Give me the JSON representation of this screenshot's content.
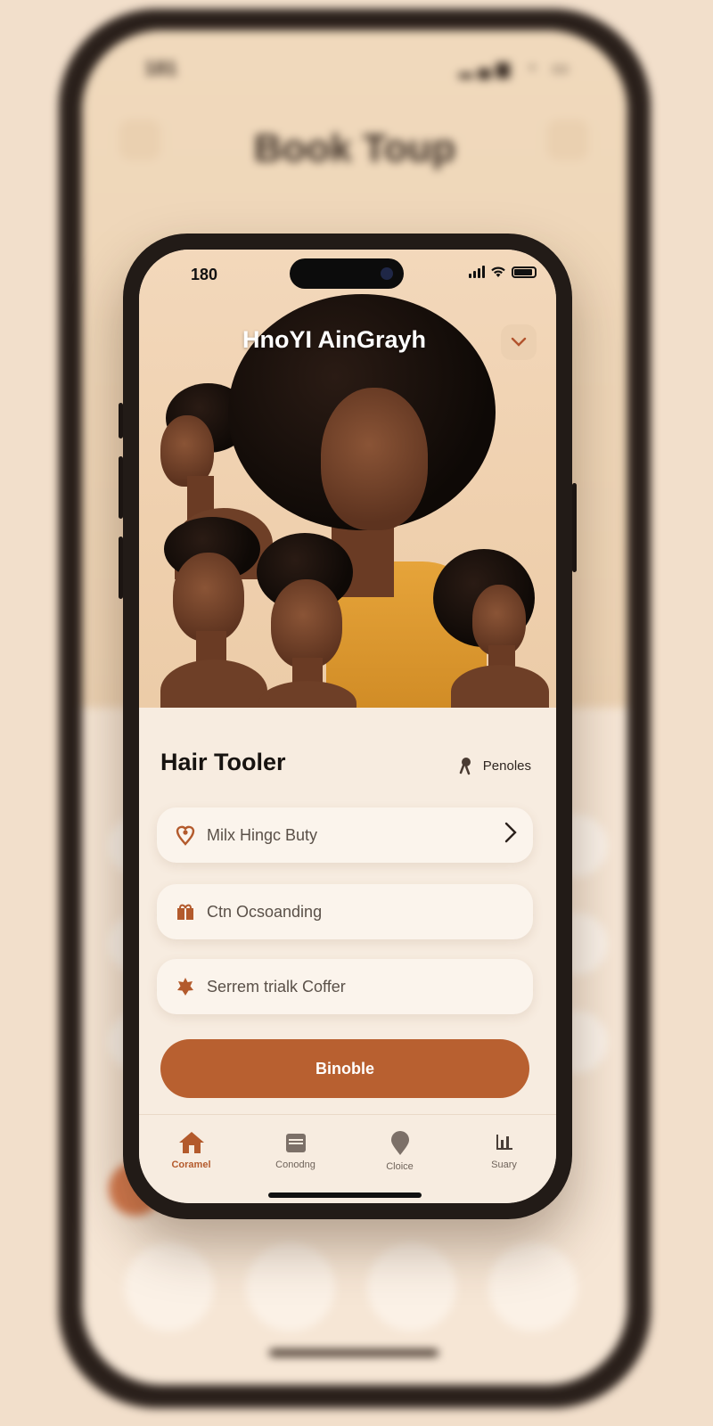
{
  "background": {
    "status_time": "181",
    "title": "Book Toup"
  },
  "status_bar": {
    "time": "180"
  },
  "header": {
    "title": "HnoYI AinGrayh",
    "action_icon": "chevron-down-icon"
  },
  "section": {
    "title": "Hair Tooler",
    "link_label": "Penoles",
    "link_icon": "pin-icon"
  },
  "options": [
    {
      "label": "Milx Hingc Buty",
      "icon": "heart-pin-icon",
      "has_chevron": true
    },
    {
      "label": "Ctn Ocsoanding",
      "icon": "gift-icon",
      "has_chevron": false
    },
    {
      "label": "Serrem trialk Coffer",
      "icon": "star-badge-icon",
      "has_chevron": false
    }
  ],
  "cta": {
    "label": "Binoble"
  },
  "tabbar": {
    "items": [
      {
        "label": "Coramel",
        "icon": "home-icon",
        "active": true
      },
      {
        "label": "Conodng",
        "icon": "calendar-icon",
        "active": false
      },
      {
        "label": "Cloice",
        "icon": "location-icon",
        "active": false
      },
      {
        "label": "Suary",
        "icon": "chart-icon",
        "active": false
      }
    ]
  },
  "colors": {
    "accent": "#b86030",
    "background": "#f7ece0",
    "hero": "#efd0ae",
    "text": "#171310"
  }
}
